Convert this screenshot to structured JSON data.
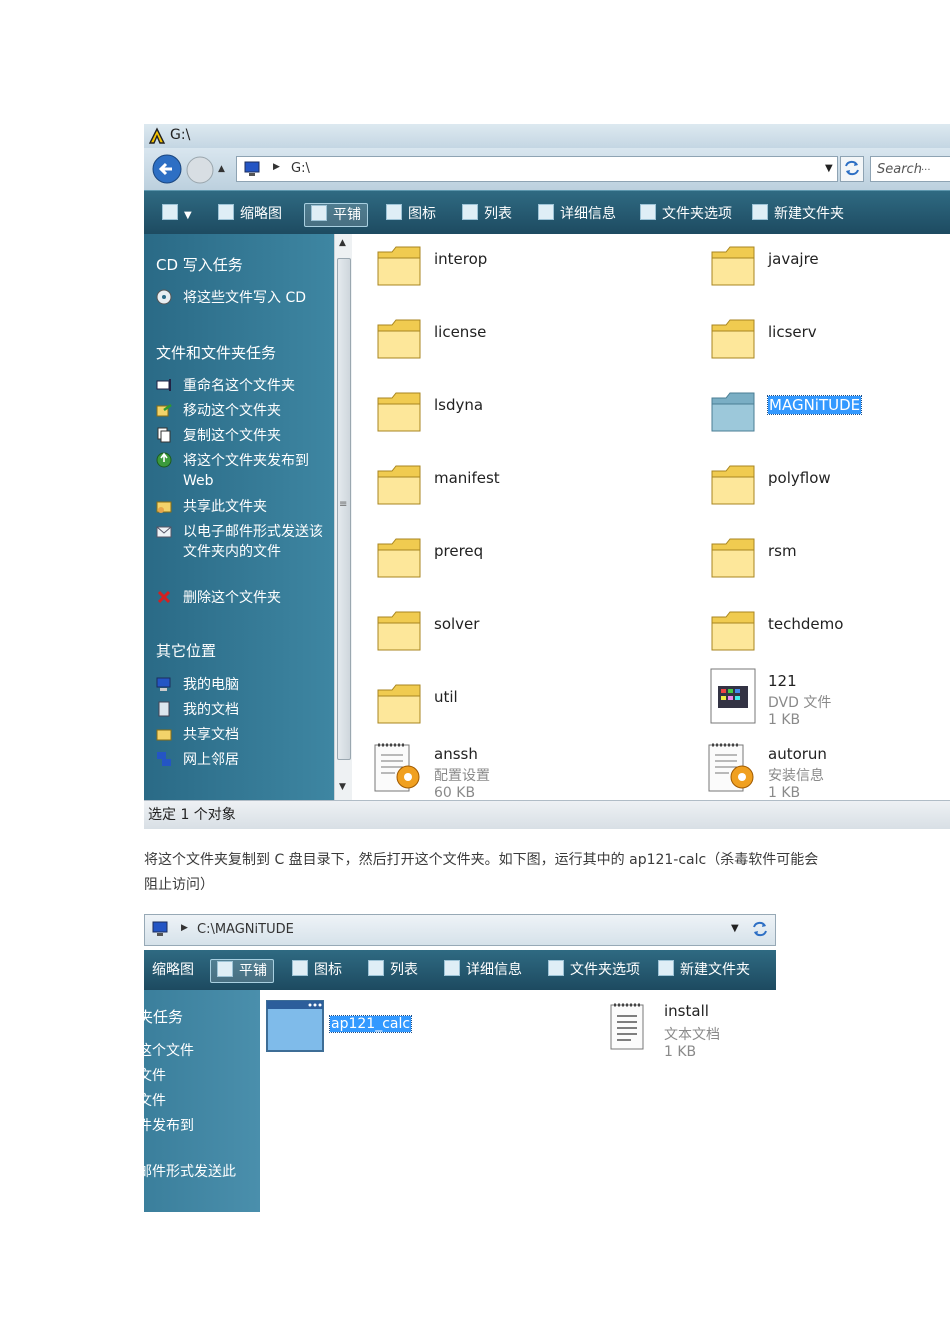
{
  "window1": {
    "title": "G:\\",
    "address": "G:\\",
    "search_placeholder": "Search",
    "search_ellipsis": "...",
    "toolbar": [
      "缩略图",
      "平铺",
      "图标",
      "列表",
      "详细信息",
      "文件夹选项",
      "新建文件夹"
    ],
    "sidebar": {
      "cd_tasks_title": "CD 写入任务",
      "cd_write": "将这些文件写入 CD",
      "file_tasks_title": "文件和文件夹任务",
      "file_tasks": [
        "重命名这个文件夹",
        "移动这个文件夹",
        "复制这个文件夹",
        "将这个文件夹发布到 Web",
        "共享此文件夹",
        "以电子邮件形式发送该文件夹内的文件",
        "删除这个文件夹"
      ],
      "other_title": "其它位置",
      "other": [
        "我的电脑",
        "我的文档",
        "共享文档",
        "网上邻居"
      ]
    },
    "files": [
      {
        "name": "interop"
      },
      {
        "name": "javajre"
      },
      {
        "name": "license"
      },
      {
        "name": "licserv"
      },
      {
        "name": "lsdyna"
      },
      {
        "name": "MAGNiTUDE"
      },
      {
        "name": "manifest"
      },
      {
        "name": "polyflow"
      },
      {
        "name": "prereq"
      },
      {
        "name": "rsm"
      },
      {
        "name": "solver"
      },
      {
        "name": "techdemo"
      },
      {
        "name": "util"
      },
      {
        "name": "121",
        "type": "DVD 文件",
        "size": "1 KB"
      },
      {
        "name": "anssh",
        "type": "配置设置",
        "size": "60 KB"
      },
      {
        "name": "autorun",
        "type": "安装信息",
        "size": "1 KB"
      }
    ],
    "status": "选定 1 个对象"
  },
  "caption": "将这个文件夹复制到 C 盘目录下，然后打开这个文件夹。如下图，运行其中的 ap121-calc（杀毒软件可能会阻止访问）",
  "window2": {
    "address": "C:\\MAGNiTUDE",
    "toolbar": [
      "缩略图",
      "平铺",
      "图标",
      "列表",
      "详细信息",
      "文件夹选项",
      "新建文件夹"
    ],
    "sidebar": [
      "夹任务",
      "这个文件",
      "文件",
      "文件",
      "件发布到",
      "邮件形式发送此"
    ],
    "files": [
      {
        "name": "ap121_calc"
      },
      {
        "name": "install",
        "type": "文本文档",
        "size": "1 KB"
      }
    ]
  },
  "colors": {
    "accent": "#3399ff",
    "toolbar": "#245a72",
    "sidebar": "#3a7f9e"
  }
}
